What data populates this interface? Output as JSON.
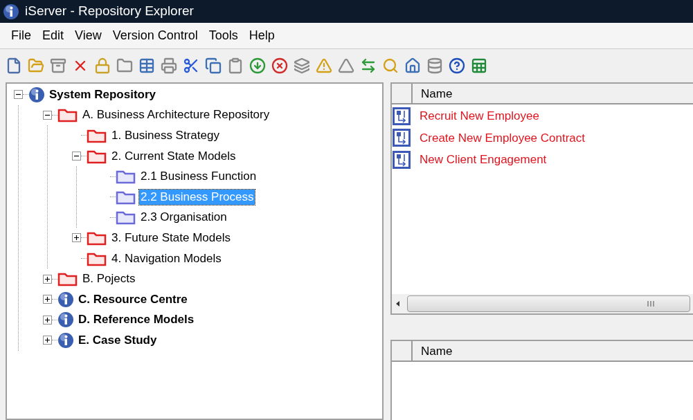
{
  "window": {
    "title": "iServer - Repository Explorer"
  },
  "menu": [
    "File",
    "Edit",
    "View",
    "Version Control",
    "Tools",
    "Help"
  ],
  "toolbar": [
    {
      "disabled": false
    },
    {
      "disabled": false
    },
    {
      "disabled": true
    },
    {
      "disabled": false
    },
    {
      "disabled": false
    },
    {
      "disabled": true
    },
    {
      "disabled": false
    },
    {
      "disabled": true
    },
    {
      "disabled": false
    },
    {
      "disabled": false
    },
    {
      "disabled": true
    },
    {
      "disabled": false
    },
    {
      "disabled": false
    },
    {
      "disabled": true
    },
    {
      "disabled": false
    },
    {
      "disabled": true
    },
    {
      "disabled": false
    },
    {
      "disabled": false
    },
    {
      "disabled": false
    },
    {
      "disabled": true
    },
    {
      "disabled": false
    },
    {
      "disabled": false
    }
  ],
  "tree": [
    {
      "label": "System Repository",
      "kind": "info",
      "expanded": true,
      "selected": false,
      "children": [
        {
          "label": "A. Business Architecture Repository",
          "kind": "folder",
          "expanded": true,
          "selected": false,
          "children": [
            {
              "label": "1. Business Strategy",
              "kind": "folder",
              "selected": false
            },
            {
              "label": "2. Current State Models",
              "kind": "folder",
              "expanded": true,
              "selected": false,
              "children": [
                {
                  "label": "2.1 Business Function",
                  "kind": "subfolder",
                  "selected": false
                },
                {
                  "label": "2.2 Business Process",
                  "kind": "subfolder",
                  "selected": true
                },
                {
                  "label": "2.3 Organisation",
                  "kind": "subfolder",
                  "selected": false
                }
              ]
            },
            {
              "label": "3. Future State Models",
              "kind": "folder",
              "expanded": false,
              "selected": false
            },
            {
              "label": "4. Navigation Models",
              "kind": "folder",
              "selected": false
            }
          ]
        },
        {
          "label": "B. Pojects",
          "kind": "folder",
          "expanded": false,
          "selected": false
        },
        {
          "label": "C. Resource Centre",
          "kind": "info",
          "expanded": false,
          "selected": false
        },
        {
          "label": "D. Reference Models",
          "kind": "info",
          "expanded": false,
          "selected": false
        },
        {
          "label": "E. Case Study",
          "kind": "info",
          "expanded": false,
          "selected": false
        }
      ]
    }
  ],
  "top_list": {
    "columns": [
      "Name"
    ],
    "rows": [
      "Recruit New Employee",
      "Create New Employee Contract",
      "New Client Engagement"
    ]
  },
  "bottom_list": {
    "columns": [
      "Name"
    ]
  }
}
